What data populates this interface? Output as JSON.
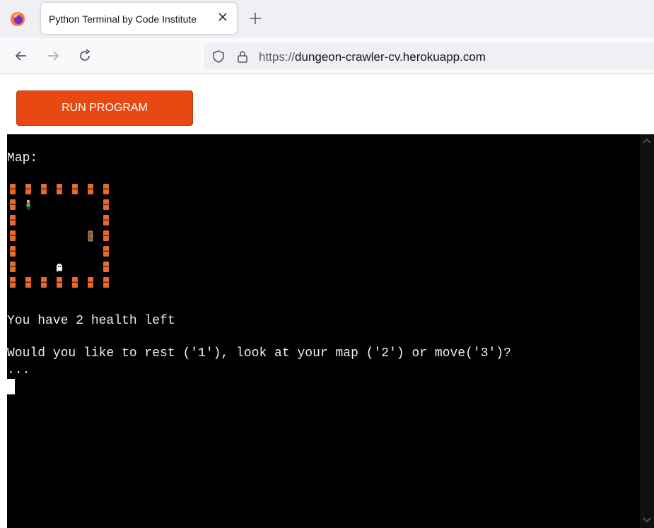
{
  "browser": {
    "tab_title": "Python Terminal by Code Institute",
    "url_protocol": "https://",
    "url_host": "dungeon-crawler-cv.herokuapp.com"
  },
  "page": {
    "run_button_label": "RUN PROGRAM"
  },
  "terminal": {
    "map_label": "Map:",
    "map": {
      "columns": 7,
      "rows": 7,
      "wall": "brick",
      "player": "person",
      "door": "door",
      "enemy": "ghost"
    },
    "health_line": "You have 2 health left",
    "prompt_line": "Would you like to rest ('1'), look at your map ('2') or move('3')?",
    "ellipsis": "..."
  },
  "colors": {
    "run_button": "#e84912",
    "terminal_bg": "#000000",
    "terminal_text": "#f0f0f0",
    "brick": "#e66a2c"
  }
}
